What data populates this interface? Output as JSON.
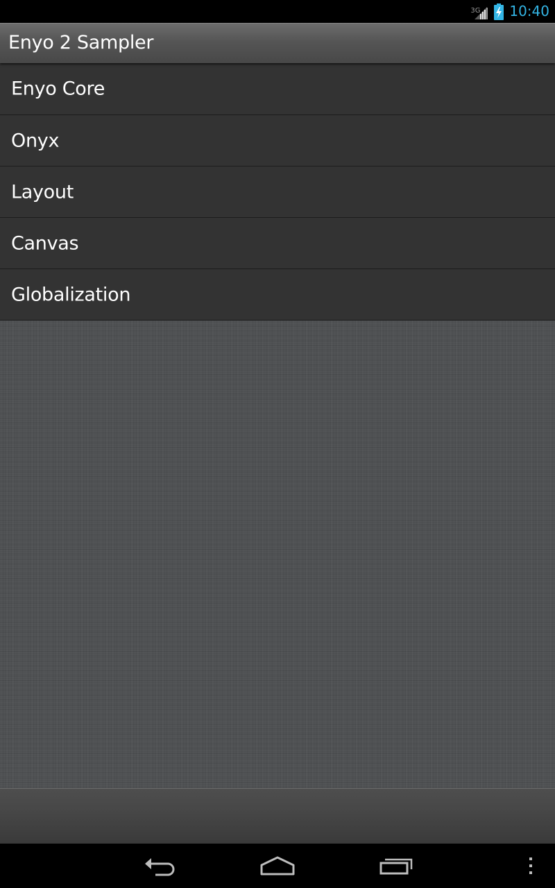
{
  "status_bar": {
    "network_type": "3G",
    "clock": "10:40",
    "clock_color": "#33b5e5",
    "icons": [
      "signal-icon",
      "battery-charging-icon"
    ]
  },
  "header": {
    "title": "Enyo 2 Sampler"
  },
  "list": {
    "items": [
      {
        "label": "Enyo Core"
      },
      {
        "label": "Onyx"
      },
      {
        "label": "Layout"
      },
      {
        "label": "Canvas"
      },
      {
        "label": "Globalization"
      }
    ]
  },
  "nav_bar": {
    "icons": [
      "back-icon",
      "home-icon",
      "recents-icon",
      "overflow-menu-icon"
    ]
  }
}
